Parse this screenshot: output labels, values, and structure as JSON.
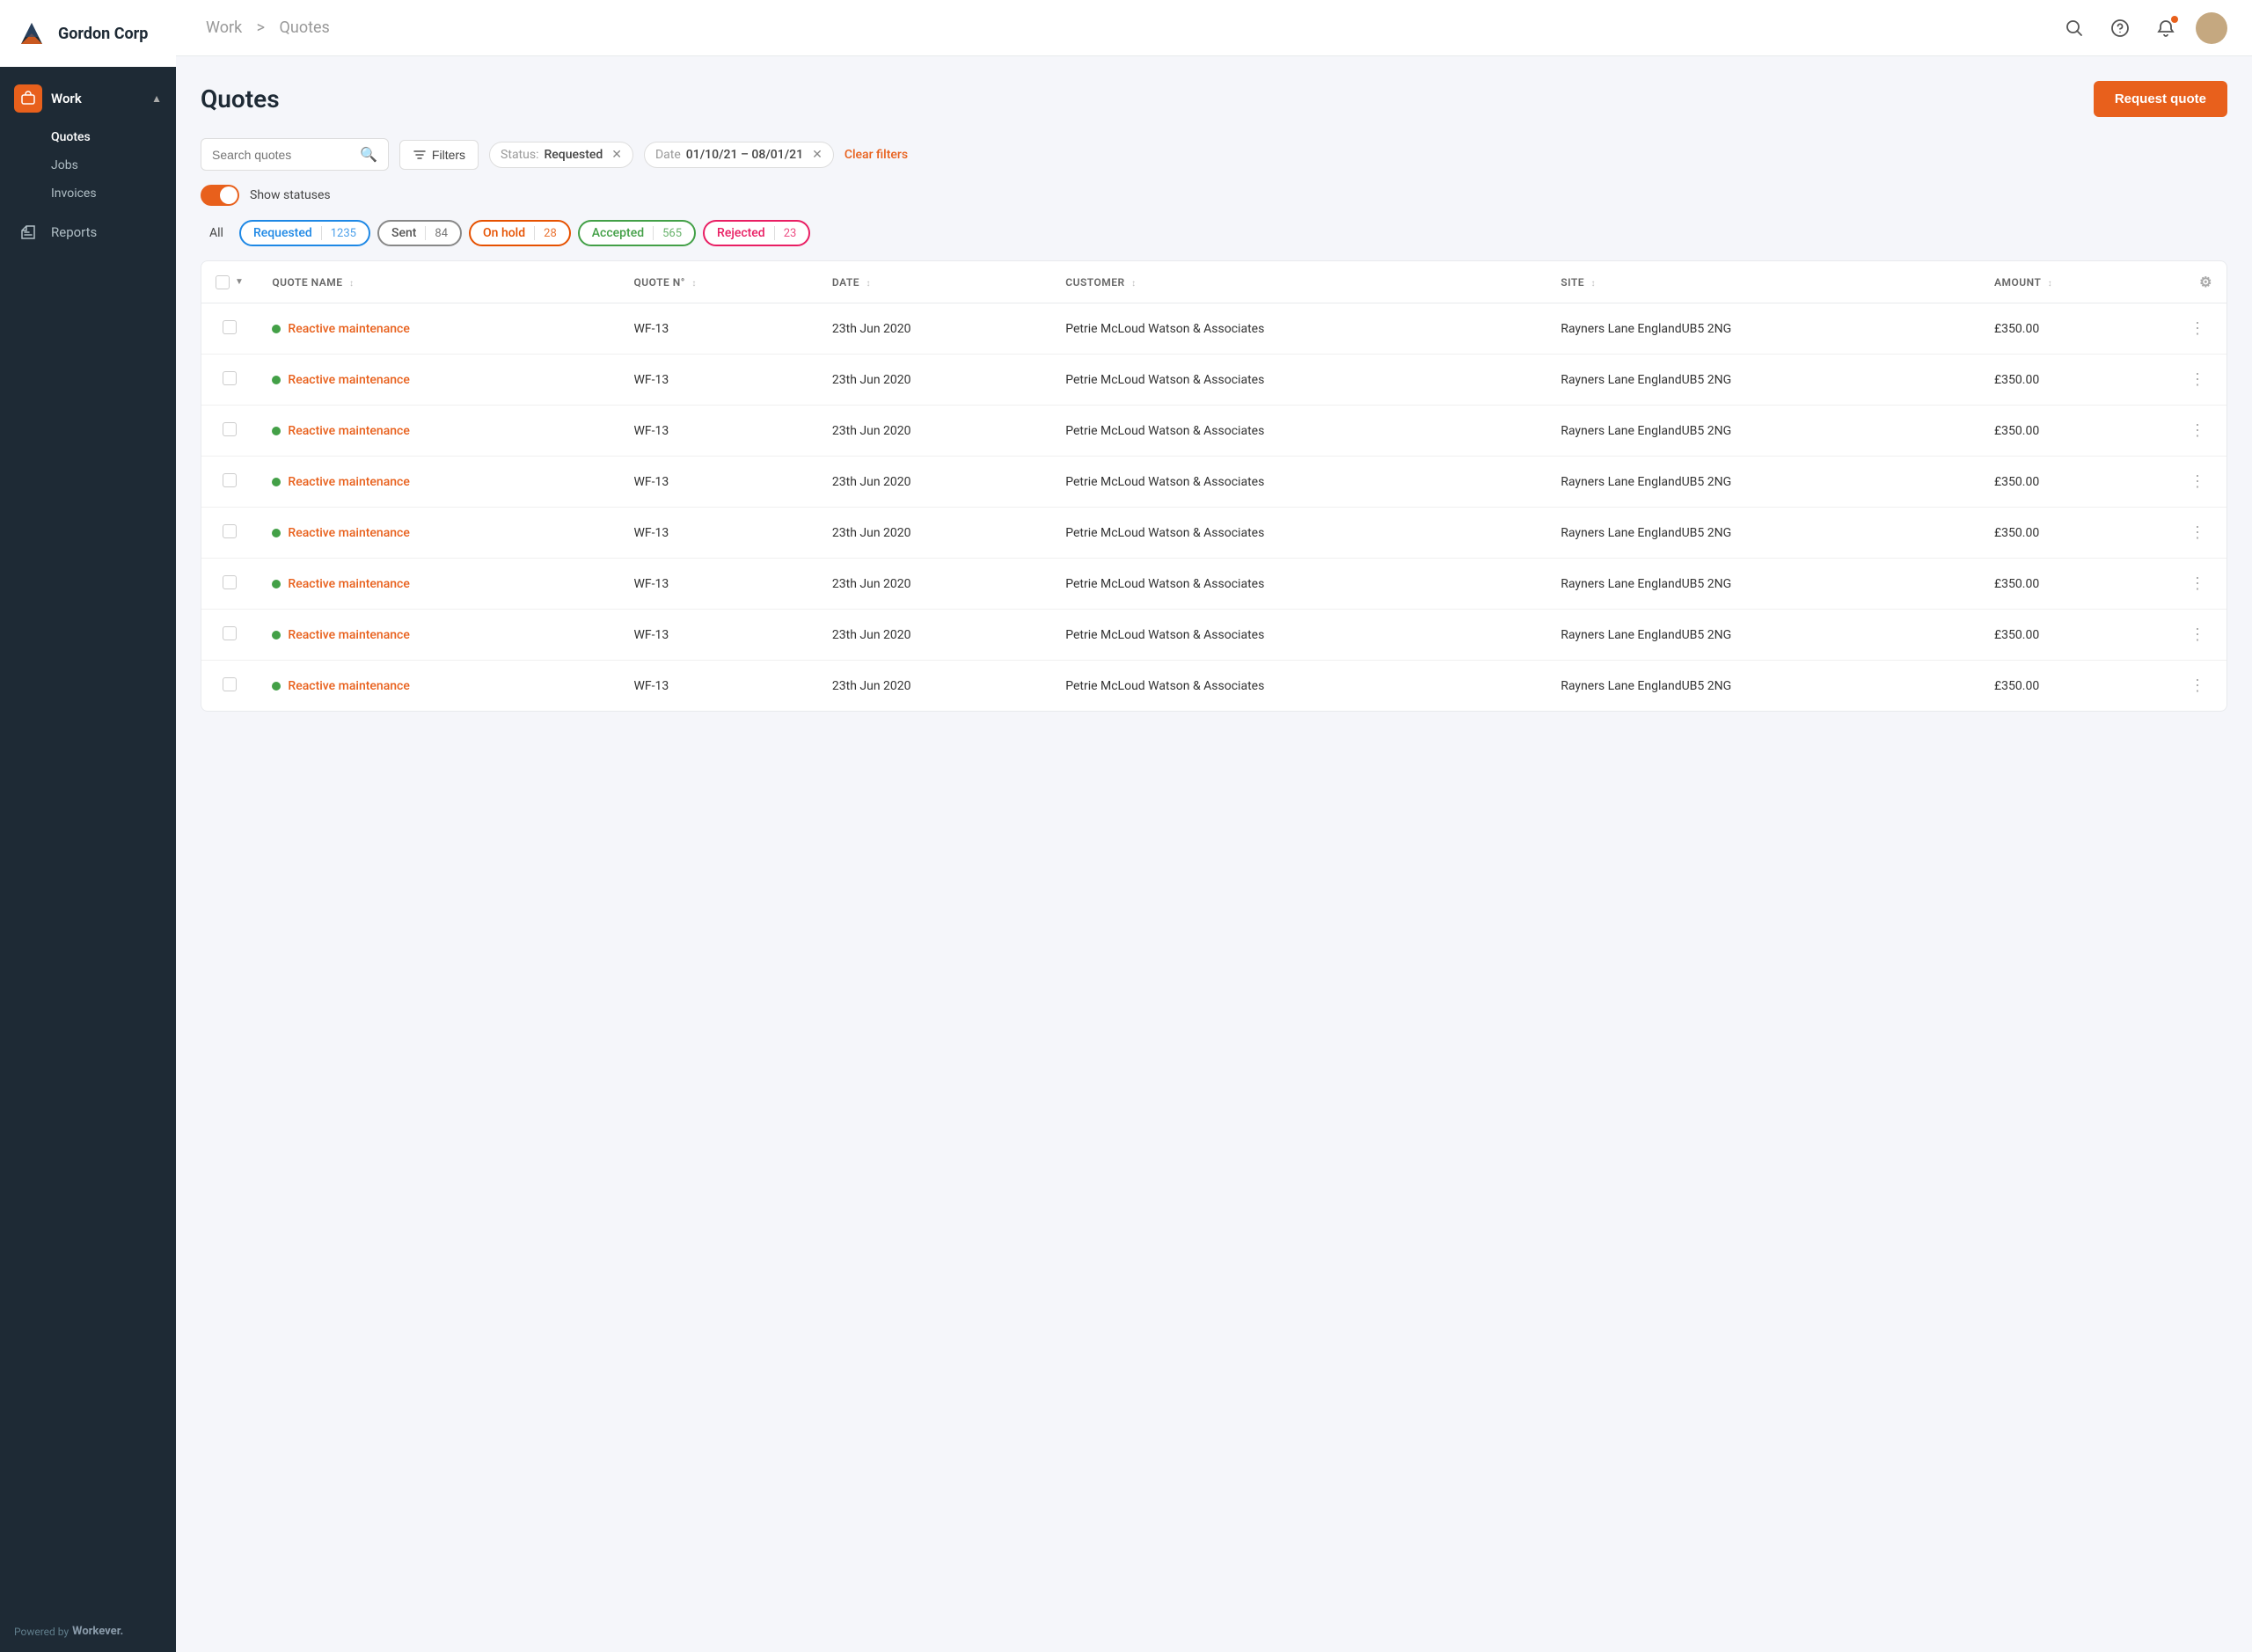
{
  "app": {
    "company": "Gordon Corp",
    "powered_by": "Powered by",
    "brand": "Workever."
  },
  "sidebar": {
    "work_label": "Work",
    "sub_items": [
      {
        "id": "quotes",
        "label": "Quotes",
        "active": true
      },
      {
        "id": "jobs",
        "label": "Jobs",
        "active": false
      },
      {
        "id": "invoices",
        "label": "Invoices",
        "active": false
      }
    ],
    "reports_label": "Reports"
  },
  "topbar": {
    "breadcrumb_root": "Work",
    "breadcrumb_separator": ">",
    "breadcrumb_current": "Quotes"
  },
  "page": {
    "title": "Quotes",
    "request_quote_btn": "Request quote"
  },
  "filters": {
    "search_placeholder": "Search quotes",
    "filters_btn": "Filters",
    "status_label": "Status:",
    "status_value": "Requested",
    "date_label": "Date",
    "date_value": "01/10/21 – 08/01/21",
    "clear_filters": "Clear filters"
  },
  "statuses_toggle": {
    "label": "Show statuses",
    "enabled": true
  },
  "status_tabs": {
    "all": "All",
    "tabs": [
      {
        "id": "requested",
        "label": "Requested",
        "count": "1235",
        "style": "requested"
      },
      {
        "id": "sent",
        "label": "Sent",
        "count": "84",
        "style": "sent"
      },
      {
        "id": "on-hold",
        "label": "On hold",
        "count": "28",
        "style": "on-hold"
      },
      {
        "id": "accepted",
        "label": "Accepted",
        "count": "565",
        "style": "accepted"
      },
      {
        "id": "rejected",
        "label": "Rejected",
        "count": "23",
        "style": "rejected"
      }
    ]
  },
  "table": {
    "columns": [
      {
        "id": "select",
        "label": ""
      },
      {
        "id": "quote_name",
        "label": "QUOTE NAME"
      },
      {
        "id": "quote_no",
        "label": "QUOTE N°"
      },
      {
        "id": "date",
        "label": "DATE"
      },
      {
        "id": "customer",
        "label": "CUSTOMER"
      },
      {
        "id": "site",
        "label": "SITE"
      },
      {
        "id": "amount",
        "label": "AMOUNT"
      },
      {
        "id": "actions",
        "label": ""
      }
    ],
    "rows": [
      {
        "quote_name": "Reactive maintenance",
        "quote_no": "WF-13",
        "date": "23th Jun 2020",
        "customer": "Petrie McLoud Watson & Associates",
        "site": "Rayners Lane EnglandUB5 2NG",
        "amount": "£350.00"
      },
      {
        "quote_name": "Reactive maintenance",
        "quote_no": "WF-13",
        "date": "23th Jun 2020",
        "customer": "Petrie McLoud Watson & Associates",
        "site": "Rayners Lane EnglandUB5 2NG",
        "amount": "£350.00"
      },
      {
        "quote_name": "Reactive maintenance",
        "quote_no": "WF-13",
        "date": "23th Jun 2020",
        "customer": "Petrie McLoud Watson & Associates",
        "site": "Rayners Lane EnglandUB5 2NG",
        "amount": "£350.00"
      },
      {
        "quote_name": "Reactive maintenance",
        "quote_no": "WF-13",
        "date": "23th Jun 2020",
        "customer": "Petrie McLoud Watson & Associates",
        "site": "Rayners Lane EnglandUB5 2NG",
        "amount": "£350.00"
      },
      {
        "quote_name": "Reactive maintenance",
        "quote_no": "WF-13",
        "date": "23th Jun 2020",
        "customer": "Petrie McLoud Watson & Associates",
        "site": "Rayners Lane EnglandUB5 2NG",
        "amount": "£350.00"
      },
      {
        "quote_name": "Reactive maintenance",
        "quote_no": "WF-13",
        "date": "23th Jun 2020",
        "customer": "Petrie McLoud Watson & Associates",
        "site": "Rayners Lane EnglandUB5 2NG",
        "amount": "£350.00"
      },
      {
        "quote_name": "Reactive maintenance",
        "quote_no": "WF-13",
        "date": "23th Jun 2020",
        "customer": "Petrie McLoud Watson & Associates",
        "site": "Rayners Lane EnglandUB5 2NG",
        "amount": "£350.00"
      },
      {
        "quote_name": "Reactive maintenance",
        "quote_no": "WF-13",
        "date": "23th Jun 2020",
        "customer": "Petrie McLoud Watson & Associates",
        "site": "Rayners Lane EnglandUB5 2NG",
        "amount": "£350.00"
      }
    ]
  }
}
